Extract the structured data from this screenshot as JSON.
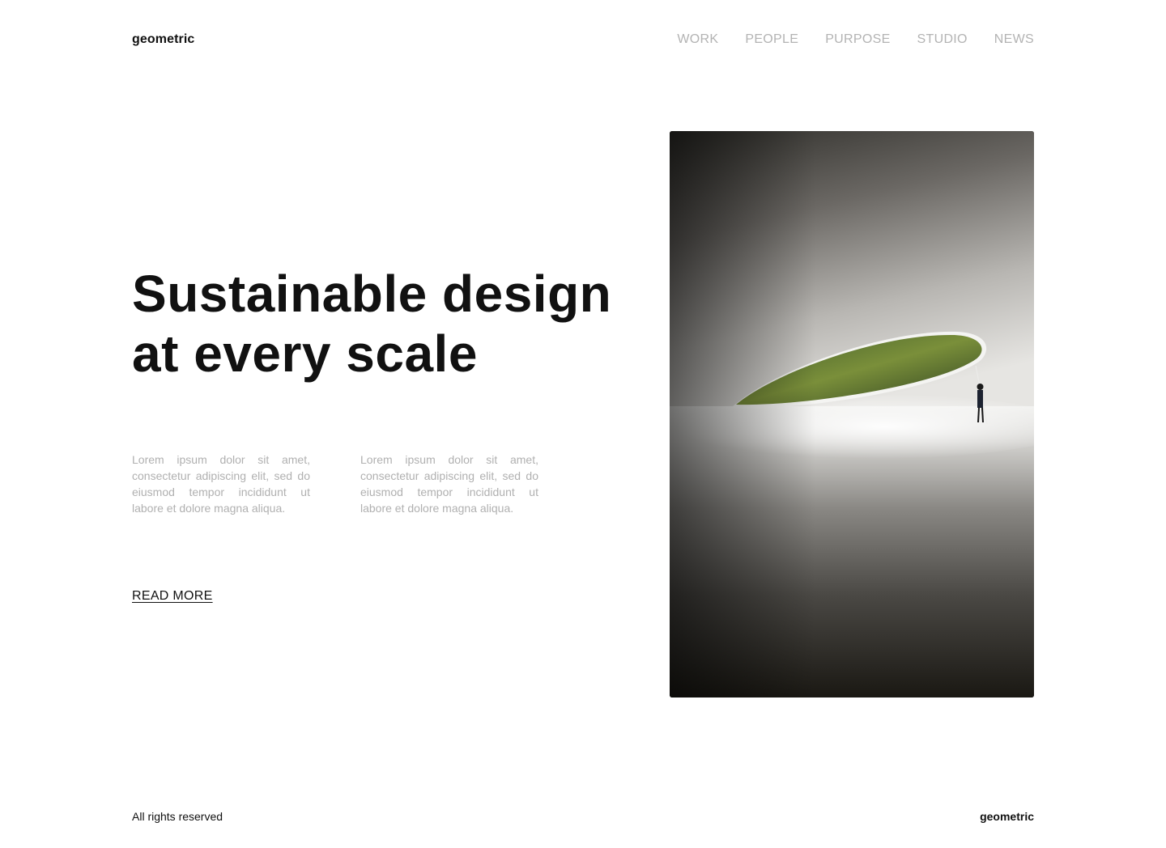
{
  "header": {
    "logo": "geometric",
    "nav": [
      "WORK",
      "PEOPLE",
      "PURPOSE",
      "STUDIO",
      "NEWS"
    ]
  },
  "hero": {
    "title_line1": "Sustainable design",
    "title_line2": "at every scale",
    "paragraphs": [
      "Lorem ipsum dolor sit amet, consectetur adipiscing elit, sed do eiusmod tempor incididunt ut labore et dolore magna aliqua.",
      "Lorem ipsum dolor sit amet, consectetur adipiscing elit, sed do eiusmod tempor incididunt ut labore et dolore magna aliqua."
    ],
    "cta_label": "READ MORE"
  },
  "footer": {
    "copyright": "All rights reserved",
    "logo": "geometric"
  },
  "colors": {
    "text_primary": "#111111",
    "text_muted": "#b0b0b0",
    "nav_muted": "#b3b3b3",
    "background": "#ffffff"
  }
}
